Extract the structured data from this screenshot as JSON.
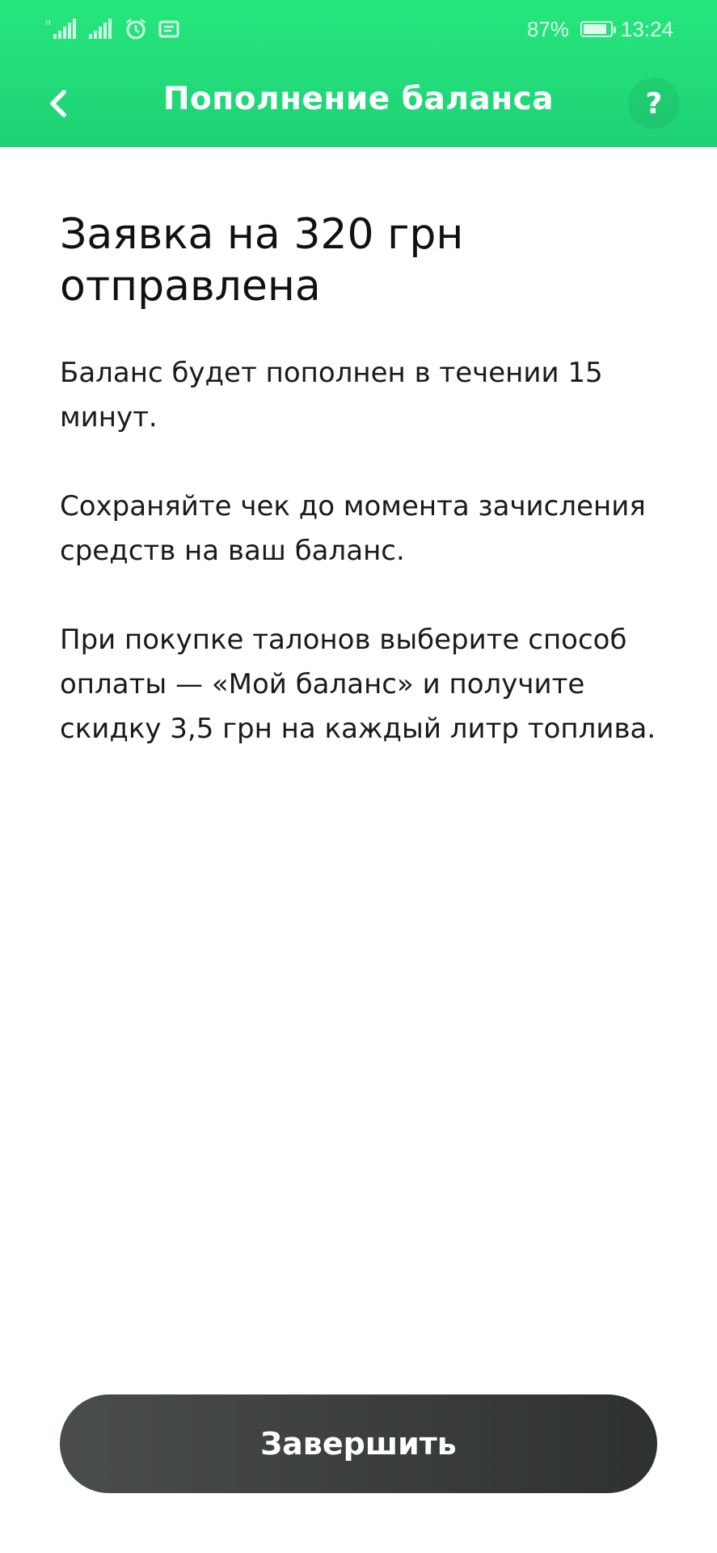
{
  "status_bar": {
    "battery_percent_text": "87%",
    "battery_level": 0.87,
    "time": "13:24",
    "icons": [
      "signal-icon",
      "signal-icon",
      "alarm-icon",
      "message-icon"
    ]
  },
  "header": {
    "title": "Пополнение баланса",
    "back_icon": "chevron-left-icon",
    "help_label": "?"
  },
  "main": {
    "heading": "Заявка на 320 грн отправлена",
    "paragraphs": [
      "Баланс будет пополнен в течении 15 минут.",
      "Сохраняйте чек до момента зачисления средств на ваш баланс.",
      "При покупке талонов выберите способ оплаты — «Мой баланс» и получите скидку 3,5 грн на каждый литр топлива."
    ]
  },
  "footer": {
    "finish_label": "Завершить"
  },
  "colors": {
    "accent_green": "#23e07a",
    "button_dark": "#3a3d3d"
  }
}
